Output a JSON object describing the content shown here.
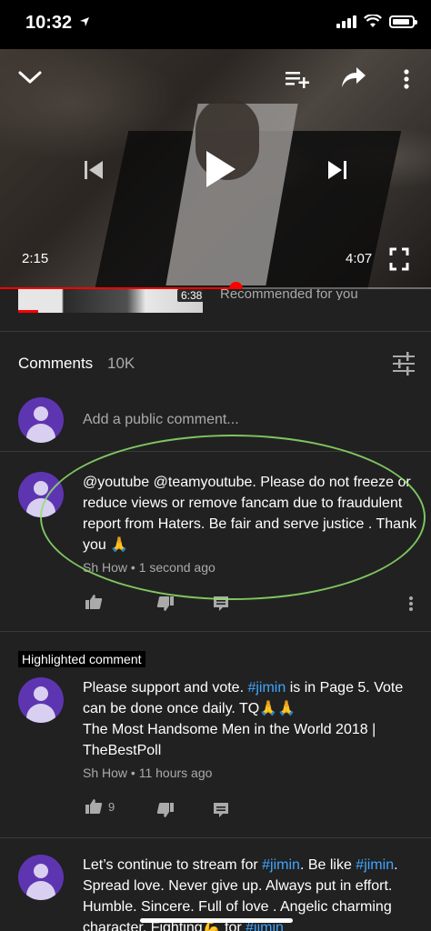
{
  "status_bar": {
    "time": "10:32"
  },
  "player": {
    "elapsed": "2:15",
    "duration": "4:07",
    "progress_fraction": 0.546
  },
  "recommended": {
    "thumb_duration": "6:38",
    "label": "Recommended for you"
  },
  "comments": {
    "header_label": "Comments",
    "count": "10K",
    "add_placeholder": "Add a public comment...",
    "items": [
      {
        "text": "@youtube @teamyoutube. Please do not freeze or reduce views or remove fancam due to fraudulent report from Haters. Be fair and serve justice . Thank you 🙏",
        "author": "Sh How",
        "time": "1 second ago",
        "likes": ""
      },
      {
        "badge": "Highlighted comment",
        "text_parts": [
          "Please support and vote. ",
          "#jimin",
          " is in Page 5. Vote can be done once daily. TQ🙏🙏",
          "The Most Handsome Men in the World 2018 | TheBestPoll"
        ],
        "author": "Sh How",
        "time": "11 hours ago",
        "likes": "9"
      },
      {
        "text_parts": [
          "Let’s continue to stream for ",
          "#jimin",
          ". Be like ",
          "#jimin",
          ".",
          "Spread love. Never give up. Always put in effort. Humble. Sincere. Full of love . Angelic charming character. Fighting💪 for ",
          "#jimin"
        ]
      }
    ]
  },
  "colors": {
    "background": "#212121",
    "accent_red": "#ff0000",
    "avatar_purple": "#5e35b1",
    "hashtag_blue": "#3ea6ff",
    "annotation_green": "#8fe06a"
  }
}
